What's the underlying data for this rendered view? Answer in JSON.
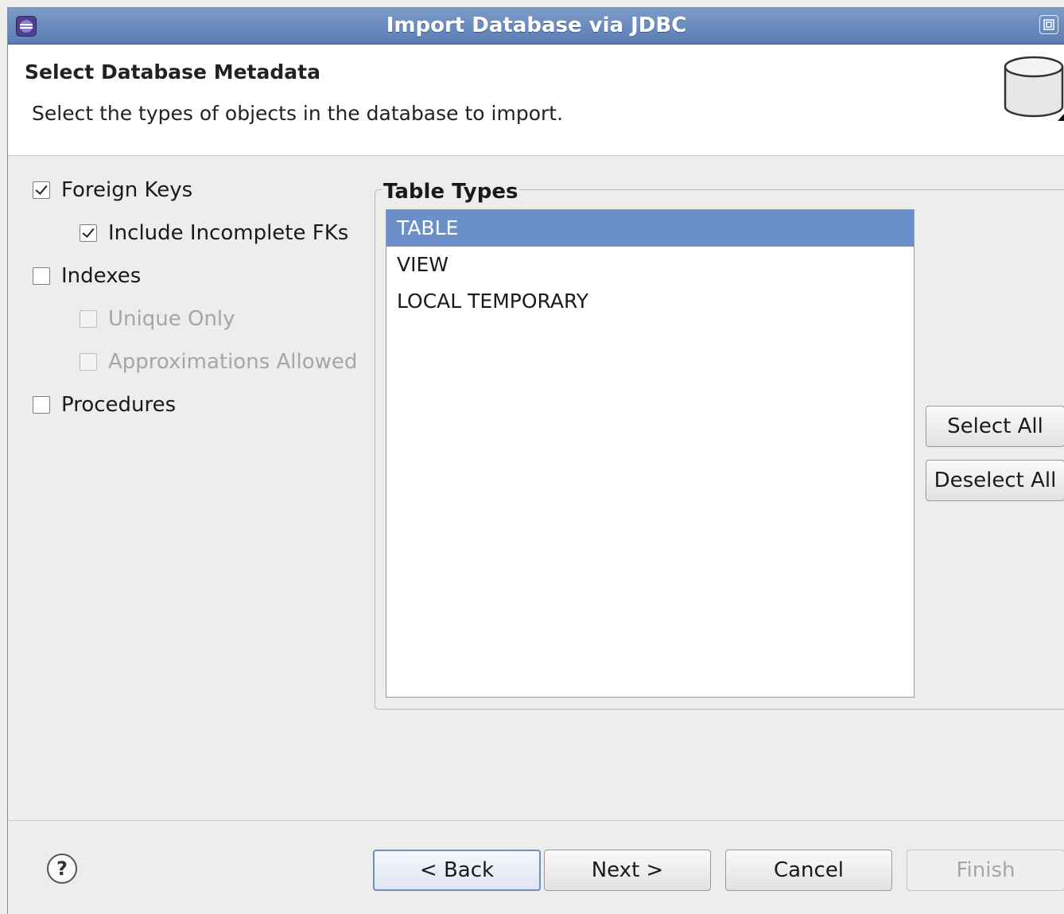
{
  "window": {
    "title": "Import Database via JDBC"
  },
  "header": {
    "title": "Select Database Metadata",
    "description": "Select the types of objects in the database to import."
  },
  "options": {
    "foreign_keys": {
      "label": "Foreign Keys",
      "checked": true
    },
    "include_incomplete_fks": {
      "label": "Include Incomplete FKs",
      "checked": true
    },
    "indexes": {
      "label": "Indexes",
      "checked": false
    },
    "unique_only": {
      "label": "Unique Only",
      "checked": false,
      "enabled": false
    },
    "approximations_allowed": {
      "label": "Approximations Allowed",
      "checked": false,
      "enabled": false
    },
    "procedures": {
      "label": "Procedures",
      "checked": false
    }
  },
  "table_types": {
    "label": "Table Types",
    "items": [
      {
        "label": "TABLE",
        "selected": true
      },
      {
        "label": "VIEW",
        "selected": false
      },
      {
        "label": "LOCAL TEMPORARY",
        "selected": false
      }
    ],
    "select_all_label": "Select All",
    "deselect_all_label": "Deselect All"
  },
  "footer": {
    "help_symbol": "?",
    "back_label": "< Back",
    "next_label": "Next >",
    "cancel_label": "Cancel",
    "finish_label": "Finish"
  },
  "colors": {
    "titlebar": "#6a8cc0",
    "selection": "#6b8fc8",
    "background": "#ededec"
  }
}
